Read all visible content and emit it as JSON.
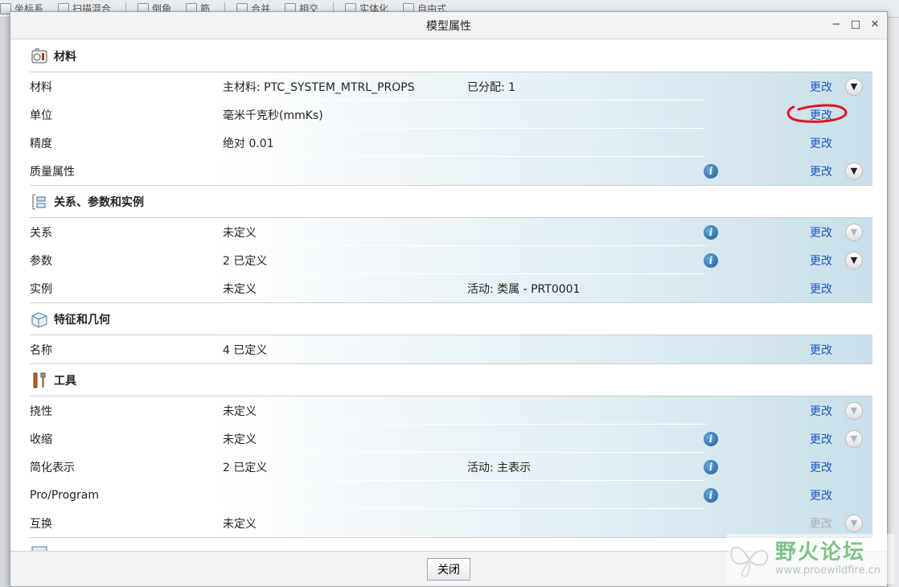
{
  "background_toolbar": {
    "items": [
      "坐标系",
      "扫描混合",
      "倒角",
      "筋",
      "合并",
      "相交",
      "实体化",
      "自由式"
    ]
  },
  "dialog": {
    "title": "模型属性",
    "window_controls": {
      "minimize": "−",
      "maximize": "□",
      "close": "✕"
    },
    "close_button": "关闭"
  },
  "sections": [
    {
      "title": "材料",
      "icon": "material-icon",
      "rows": [
        {
          "label": "材料",
          "value": "主材料: PTC_SYSTEM_MTRL_PROPS",
          "extra": "已分配: 1",
          "info": false,
          "change": "更改",
          "change_enabled": true,
          "expand": "active"
        },
        {
          "label": "单位",
          "value": "毫米千克秒(mmKs)",
          "extra": "",
          "info": false,
          "change": "更改",
          "change_enabled": true,
          "expand": "none"
        },
        {
          "label": "精度",
          "value": "绝对 0.01",
          "extra": "",
          "info": false,
          "change": "更改",
          "change_enabled": true,
          "expand": "none"
        },
        {
          "label": "质量属性",
          "value": "",
          "extra": "",
          "info": true,
          "change": "更改",
          "change_enabled": true,
          "expand": "active"
        }
      ]
    },
    {
      "title": "关系、参数和实例",
      "icon": "relations-icon",
      "rows": [
        {
          "label": "关系",
          "value": "未定义",
          "extra": "",
          "info": true,
          "change": "更改",
          "change_enabled": true,
          "expand": "dim"
        },
        {
          "label": "参数",
          "value": "2 已定义",
          "extra": "",
          "info": true,
          "change": "更改",
          "change_enabled": true,
          "expand": "active"
        },
        {
          "label": "实例",
          "value": "未定义",
          "extra": "活动: 类属 - PRT0001",
          "info": false,
          "change": "更改",
          "change_enabled": true,
          "expand": "none"
        }
      ]
    },
    {
      "title": "特征和几何",
      "icon": "feature-icon",
      "rows": [
        {
          "label": "名称",
          "value": "4 已定义",
          "extra": "",
          "info": false,
          "change": "更改",
          "change_enabled": true,
          "expand": "none"
        }
      ]
    },
    {
      "title": "工具",
      "icon": "tools-icon",
      "rows": [
        {
          "label": "挠性",
          "value": "未定义",
          "extra": "",
          "info": false,
          "change": "更改",
          "change_enabled": true,
          "expand": "dim"
        },
        {
          "label": "收缩",
          "value": "未定义",
          "extra": "",
          "info": true,
          "change": "更改",
          "change_enabled": true,
          "expand": "dim"
        },
        {
          "label": "简化表示",
          "value": "2 已定义",
          "extra": "活动: 主表示",
          "info": true,
          "change": "更改",
          "change_enabled": true,
          "expand": "none"
        },
        {
          "label": "Pro/Program",
          "value": "",
          "extra": "",
          "info": true,
          "change": "更改",
          "change_enabled": true,
          "expand": "none"
        },
        {
          "label": "互换",
          "value": "未定义",
          "extra": "",
          "info": false,
          "change": "更改",
          "change_enabled": false,
          "expand": "dim"
        }
      ]
    }
  ],
  "watermark": {
    "name": "野火论坛",
    "url": "www.proewildfire.cn"
  },
  "colors": {
    "link": "#1a56c8",
    "band_end": "#c9dfe9",
    "annotation": "#e0141e",
    "watermark": "#7ec486"
  }
}
